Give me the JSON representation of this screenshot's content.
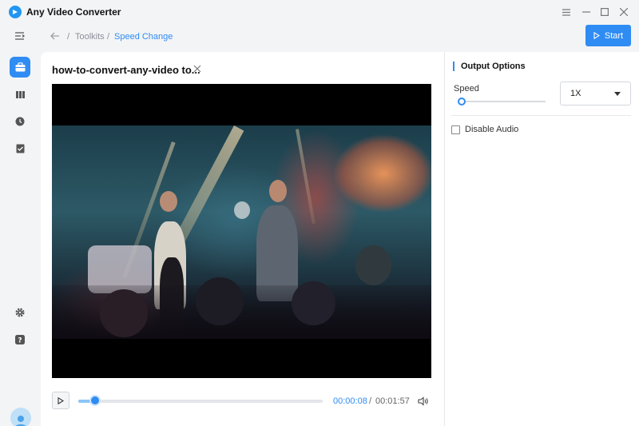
{
  "app": {
    "title": "Any Video Converter"
  },
  "breadcrumb": {
    "items": [
      "Toolkits",
      "Speed Change"
    ],
    "separator": "/"
  },
  "toolbar": {
    "start_label": "Start"
  },
  "file": {
    "name": "how-to-convert-any-video to..."
  },
  "player": {
    "current_time": "00:00:08",
    "time_separator": "/",
    "total_time": "00:01:57",
    "progress_fraction": 0.07
  },
  "options": {
    "title": "Output Options",
    "speed_label": "Speed",
    "speed_value": "1X",
    "disable_audio_label": "Disable Audio",
    "disable_audio_checked": false
  },
  "sidebar": {
    "items": [
      "menu-icon",
      "toolbox-icon",
      "film-icon",
      "clock-icon",
      "task-icon",
      "settings-icon",
      "help-icon",
      "avatar"
    ]
  },
  "colors": {
    "accent": "#2f8cf3",
    "background": "#f3f4f6",
    "panel": "#ffffff"
  }
}
